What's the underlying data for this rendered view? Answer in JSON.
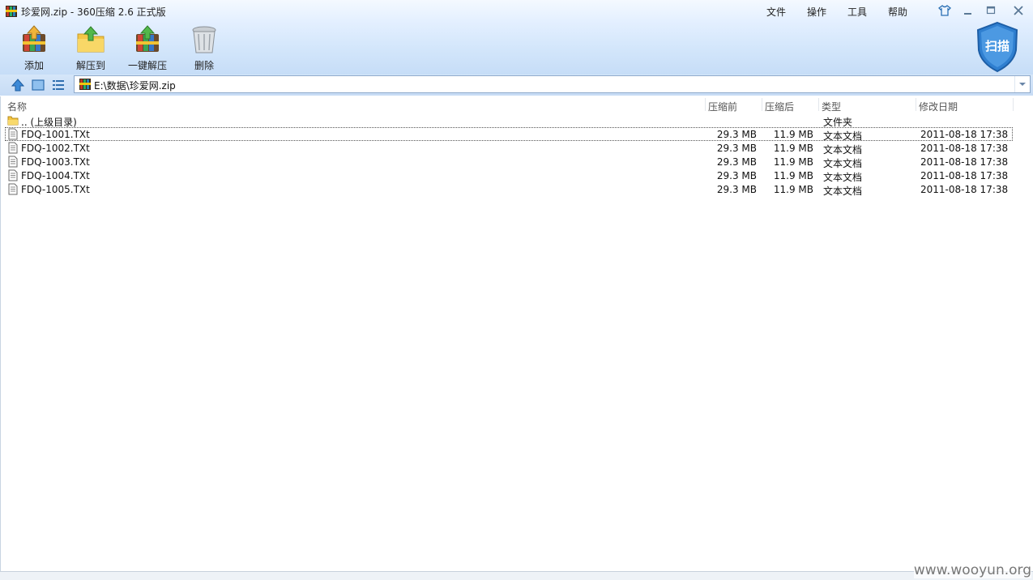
{
  "window": {
    "title": "珍爱网.zip - 360压缩 2.6 正式版"
  },
  "menu": [
    "文件",
    "操作",
    "工具",
    "帮助"
  ],
  "window_controls": {
    "skin_icon": "shirt-icon",
    "minimize_icon": "minimize-icon",
    "maximize_icon": "maximize-icon",
    "close_icon": "close-icon"
  },
  "toolbar": {
    "add": "添加",
    "extract_to": "解压到",
    "one_click_extract": "一键解压",
    "delete": "删除"
  },
  "scan": {
    "label": "扫描"
  },
  "address": {
    "path": "E:\\数据\\珍爱网.zip"
  },
  "columns": {
    "name": "名称",
    "size_before": "压缩前",
    "size_after": "压缩后",
    "type": "类型",
    "modified": "修改日期"
  },
  "parent": {
    "name": ".. (上级目录)",
    "type": "文件夹"
  },
  "files": [
    {
      "name": "FDQ-1001.TXt",
      "size_before": "29.3 MB",
      "size_after": "11.9 MB",
      "type": "文本文档",
      "modified": "2011-08-18 17:38"
    },
    {
      "name": "FDQ-1002.TXt",
      "size_before": "29.3 MB",
      "size_after": "11.9 MB",
      "type": "文本文档",
      "modified": "2011-08-18 17:38"
    },
    {
      "name": "FDQ-1003.TXt",
      "size_before": "29.3 MB",
      "size_after": "11.9 MB",
      "type": "文本文档",
      "modified": "2011-08-18 17:38"
    },
    {
      "name": "FDQ-1004.TXt",
      "size_before": "29.3 MB",
      "size_after": "11.9 MB",
      "type": "文本文档",
      "modified": "2011-08-18 17:38"
    },
    {
      "name": "FDQ-1005.TXt",
      "size_before": "29.3 MB",
      "size_after": "11.9 MB",
      "type": "文本文档",
      "modified": "2011-08-18 17:38"
    }
  ],
  "selected_index": 0,
  "watermark": "www.wooyun.org",
  "colors": {
    "accent": "#2f7fd0",
    "folder": "#f4c542"
  }
}
